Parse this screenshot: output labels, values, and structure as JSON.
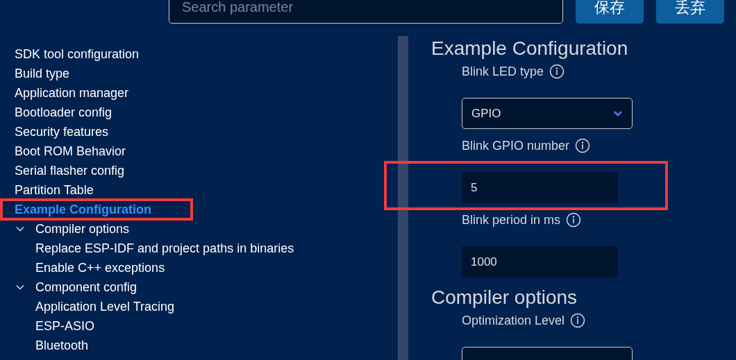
{
  "search": {
    "placeholder": "Search parameter"
  },
  "buttons": [
    {
      "label": "保存"
    },
    {
      "label": "丢弃"
    }
  ],
  "sidebar": {
    "items": [
      {
        "label": "SDK tool configuration",
        "selected": false
      },
      {
        "label": "Build type",
        "selected": false
      },
      {
        "label": "Application manager",
        "selected": false
      },
      {
        "label": "Bootloader config",
        "selected": false
      },
      {
        "label": "Security features",
        "selected": false
      },
      {
        "label": "Boot ROM Behavior",
        "selected": false
      },
      {
        "label": "Serial flasher config",
        "selected": false
      },
      {
        "label": "Partition Table",
        "selected": false
      },
      {
        "label": "Example Configuration",
        "selected": true
      },
      {
        "label": "Compiler options",
        "selected": false,
        "expanded": true,
        "children": [
          {
            "label": "Replace ESP-IDF and project paths in binaries",
            "selected": false
          },
          {
            "label": "Enable C++ exceptions",
            "selected": false
          }
        ]
      },
      {
        "label": "Component config",
        "selected": false,
        "expanded": true,
        "children": [
          {
            "label": "Application Level Tracing",
            "selected": false
          },
          {
            "label": "ESP-ASIO",
            "selected": false
          },
          {
            "label": "Bluetooth",
            "selected": false
          }
        ]
      }
    ]
  },
  "sections": [
    {
      "title": "Example Configuration",
      "fields": [
        {
          "label": "Blink LED type",
          "kind": "select",
          "value": "GPIO"
        },
        {
          "label": "Blink GPIO number",
          "kind": "number",
          "value": "5"
        },
        {
          "label": "Blink period in ms",
          "kind": "number",
          "value": "1000"
        }
      ]
    },
    {
      "title": "Compiler options",
      "fields": [
        {
          "label": "Optimization Level",
          "kind": "select"
        }
      ]
    }
  ]
}
